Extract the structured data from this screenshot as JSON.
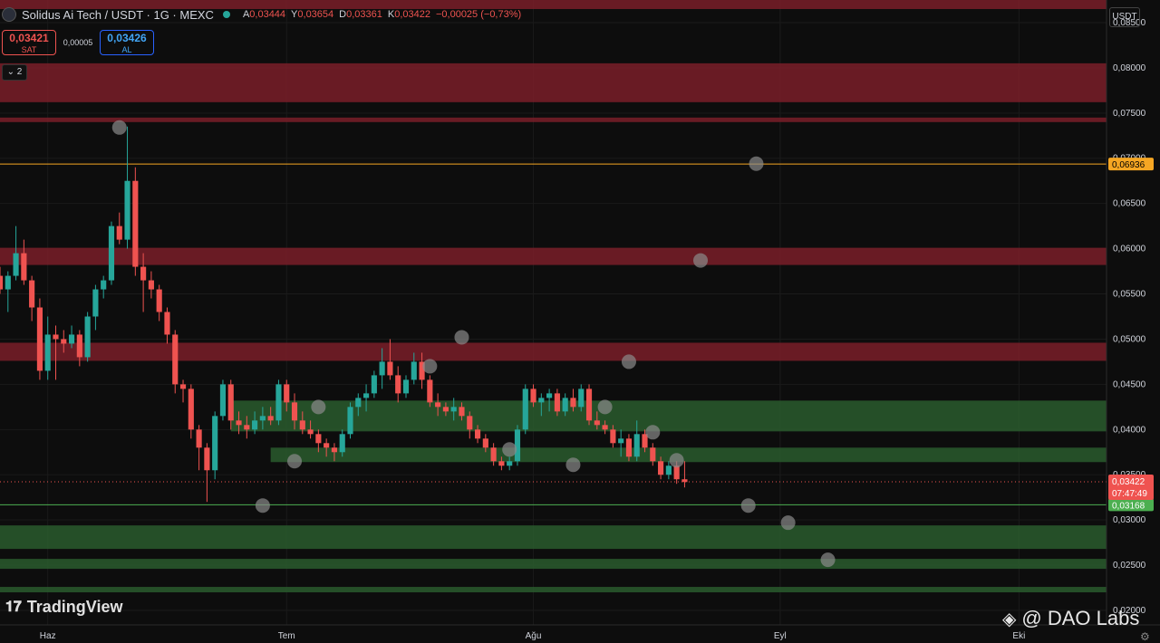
{
  "header": {
    "symbol": "Solidus Ai Tech / USDT · 1G · MEXC",
    "ohlc": [
      {
        "k": "A",
        "v": "0,03444"
      },
      {
        "k": "Y",
        "v": "0,03654"
      },
      {
        "k": "D",
        "v": "0,03361"
      },
      {
        "k": "K",
        "v": "0,03422"
      },
      {
        "k": "",
        "v": "−0,00025 (−0,73%)"
      }
    ]
  },
  "trade": {
    "sell_price": "0,03421",
    "sell_label": "SAT",
    "spread": "0,00005",
    "buy_price": "0,03426",
    "buy_label": "AL"
  },
  "collapse_label": "2",
  "currency": "USDT",
  "logo": "TradingView",
  "watermark": "@ DAO Labs",
  "colors": {
    "up": "#26a69a",
    "down": "#ef5350",
    "resistance": "#7a1f29",
    "support": "#2a5c2e",
    "orange": "#f5a623",
    "green_line": "#4caf50"
  },
  "chart_data": {
    "type": "candlestick",
    "y_ticks": [
      "0,08500",
      "0,08000",
      "0,07500",
      "0,07000",
      "0,06500",
      "0,06000",
      "0,05500",
      "0,05000",
      "0,04500",
      "0,04000",
      "0,03500",
      "0,03000",
      "0,02500",
      "0,02000"
    ],
    "y_tick_values": [
      0.085,
      0.08,
      0.075,
      0.07,
      0.065,
      0.06,
      0.055,
      0.05,
      0.045,
      0.04,
      0.035,
      0.03,
      0.025,
      0.02
    ],
    "ylim": [
      0.0184,
      0.0875
    ],
    "x_labels": [
      {
        "label": "Haz",
        "day": 0
      },
      {
        "label": "Tem",
        "day": 30
      },
      {
        "label": "Ağu",
        "day": 61
      },
      {
        "label": "Eyl",
        "day": 92
      },
      {
        "label": "Eki",
        "day": 122
      }
    ],
    "xlim_days": [
      -6,
      133
    ],
    "first_candle_day": -6,
    "candles": [
      [
        0.057,
        0.058,
        0.055,
        0.0555
      ],
      [
        0.0555,
        0.0575,
        0.053,
        0.057
      ],
      [
        0.057,
        0.0625,
        0.0565,
        0.0595
      ],
      [
        0.0595,
        0.061,
        0.056,
        0.0565
      ],
      [
        0.0565,
        0.057,
        0.052,
        0.0535
      ],
      [
        0.0535,
        0.0545,
        0.0455,
        0.0465
      ],
      [
        0.0465,
        0.0525,
        0.0455,
        0.0505
      ],
      [
        0.0505,
        0.0515,
        0.0455,
        0.05
      ],
      [
        0.05,
        0.051,
        0.0485,
        0.0495
      ],
      [
        0.0495,
        0.0515,
        0.049,
        0.0505
      ],
      [
        0.0505,
        0.051,
        0.047,
        0.048
      ],
      [
        0.048,
        0.053,
        0.0475,
        0.0525
      ],
      [
        0.0525,
        0.056,
        0.051,
        0.0555
      ],
      [
        0.0555,
        0.057,
        0.0545,
        0.0565
      ],
      [
        0.0565,
        0.063,
        0.056,
        0.0625
      ],
      [
        0.0625,
        0.064,
        0.0605,
        0.061
      ],
      [
        0.061,
        0.0735,
        0.06,
        0.0675
      ],
      [
        0.0675,
        0.069,
        0.057,
        0.058
      ],
      [
        0.058,
        0.0595,
        0.053,
        0.0565
      ],
      [
        0.0565,
        0.0575,
        0.0545,
        0.0555
      ],
      [
        0.0555,
        0.056,
        0.052,
        0.053
      ],
      [
        0.053,
        0.0535,
        0.0495,
        0.0505
      ],
      [
        0.0505,
        0.051,
        0.044,
        0.045
      ],
      [
        0.045,
        0.0455,
        0.043,
        0.0445
      ],
      [
        0.0445,
        0.045,
        0.039,
        0.04
      ],
      [
        0.04,
        0.0405,
        0.0355,
        0.038
      ],
      [
        0.038,
        0.0385,
        0.032,
        0.0355
      ],
      [
        0.0355,
        0.042,
        0.0345,
        0.0415
      ],
      [
        0.0415,
        0.0455,
        0.041,
        0.045
      ],
      [
        0.045,
        0.0455,
        0.04,
        0.041
      ],
      [
        0.041,
        0.042,
        0.0395,
        0.0405
      ],
      [
        0.0405,
        0.0415,
        0.039,
        0.04
      ],
      [
        0.04,
        0.042,
        0.0395,
        0.041
      ],
      [
        0.041,
        0.0425,
        0.04,
        0.0415
      ],
      [
        0.0415,
        0.0425,
        0.0405,
        0.041
      ],
      [
        0.041,
        0.0455,
        0.0405,
        0.045
      ],
      [
        0.045,
        0.0455,
        0.042,
        0.043
      ],
      [
        0.043,
        0.044,
        0.04,
        0.041
      ],
      [
        0.041,
        0.042,
        0.0395,
        0.04
      ],
      [
        0.04,
        0.041,
        0.039,
        0.0395
      ],
      [
        0.0395,
        0.04,
        0.0375,
        0.0385
      ],
      [
        0.0385,
        0.039,
        0.037,
        0.038
      ],
      [
        0.038,
        0.0385,
        0.0365,
        0.0375
      ],
      [
        0.0375,
        0.04,
        0.037,
        0.0395
      ],
      [
        0.0395,
        0.043,
        0.039,
        0.0425
      ],
      [
        0.0425,
        0.044,
        0.0415,
        0.0435
      ],
      [
        0.0435,
        0.045,
        0.042,
        0.044
      ],
      [
        0.044,
        0.0465,
        0.0435,
        0.046
      ],
      [
        0.046,
        0.049,
        0.0445,
        0.0475
      ],
      [
        0.0475,
        0.05,
        0.0455,
        0.046
      ],
      [
        0.046,
        0.047,
        0.043,
        0.044
      ],
      [
        0.044,
        0.046,
        0.0435,
        0.0455
      ],
      [
        0.0455,
        0.0485,
        0.045,
        0.0475
      ],
      [
        0.0475,
        0.0485,
        0.0445,
        0.0455
      ],
      [
        0.0455,
        0.046,
        0.0425,
        0.043
      ],
      [
        0.043,
        0.044,
        0.0415,
        0.0425
      ],
      [
        0.0425,
        0.043,
        0.0415,
        0.042
      ],
      [
        0.042,
        0.0435,
        0.041,
        0.0425
      ],
      [
        0.0425,
        0.043,
        0.041,
        0.0415
      ],
      [
        0.0415,
        0.042,
        0.039,
        0.04
      ],
      [
        0.04,
        0.0405,
        0.0385,
        0.039
      ],
      [
        0.039,
        0.0395,
        0.0375,
        0.038
      ],
      [
        0.038,
        0.0385,
        0.036,
        0.0365
      ],
      [
        0.0365,
        0.037,
        0.0355,
        0.036
      ],
      [
        0.036,
        0.037,
        0.0355,
        0.0365
      ],
      [
        0.0365,
        0.0405,
        0.036,
        0.04
      ],
      [
        0.04,
        0.045,
        0.0395,
        0.0445
      ],
      [
        0.0445,
        0.045,
        0.0425,
        0.043
      ],
      [
        0.043,
        0.044,
        0.0415,
        0.0435
      ],
      [
        0.0435,
        0.0445,
        0.042,
        0.044
      ],
      [
        0.044,
        0.0445,
        0.0415,
        0.042
      ],
      [
        0.042,
        0.044,
        0.0415,
        0.0435
      ],
      [
        0.0435,
        0.0445,
        0.042,
        0.0425
      ],
      [
        0.0425,
        0.045,
        0.042,
        0.0445
      ],
      [
        0.0445,
        0.045,
        0.0405,
        0.041
      ],
      [
        0.041,
        0.042,
        0.04,
        0.0405
      ],
      [
        0.0405,
        0.041,
        0.0395,
        0.04
      ],
      [
        0.04,
        0.0405,
        0.038,
        0.0385
      ],
      [
        0.0385,
        0.04,
        0.037,
        0.039
      ],
      [
        0.039,
        0.0395,
        0.0365,
        0.037
      ],
      [
        0.037,
        0.041,
        0.0365,
        0.0395
      ],
      [
        0.0395,
        0.04,
        0.0375,
        0.038
      ],
      [
        0.038,
        0.0385,
        0.036,
        0.0365
      ],
      [
        0.0365,
        0.037,
        0.0345,
        0.035
      ],
      [
        0.035,
        0.0365,
        0.0345,
        0.036
      ],
      [
        0.036,
        0.0365,
        0.034,
        0.0345
      ],
      [
        0.0345,
        0.0365,
        0.0336,
        0.0342
      ]
    ],
    "resistance_zones": [
      [
        0.0865,
        0.0888
      ],
      [
        0.0762,
        0.0805
      ],
      [
        0.074,
        0.0745
      ],
      [
        0.0582,
        0.0601
      ],
      [
        0.0476,
        0.0496
      ]
    ],
    "support_zones": [
      [
        0.0398,
        0.0432
      ],
      [
        0.0364,
        0.038
      ],
      [
        0.0268,
        0.0294
      ],
      [
        0.0246,
        0.0257
      ],
      [
        0.022,
        0.0226
      ]
    ],
    "lines": [
      {
        "price": 0.06936,
        "label": "0,06936",
        "color": "#f5a623"
      },
      {
        "price": 0.03168,
        "label": "0,03168",
        "color": "#4caf50"
      }
    ],
    "current": {
      "price": 0.03422,
      "label": "0,03422",
      "timer": "07:47:49"
    },
    "markers": [
      [
        9,
        0.0734
      ],
      [
        27,
        0.0316
      ],
      [
        31,
        0.0365
      ],
      [
        34,
        0.0425
      ],
      [
        48,
        0.047
      ],
      [
        52,
        0.0502
      ],
      [
        58,
        0.0378
      ],
      [
        66,
        0.0361
      ],
      [
        70,
        0.0425
      ],
      [
        73,
        0.0475
      ],
      [
        76,
        0.0397
      ],
      [
        79,
        0.0366
      ],
      [
        82,
        0.0587
      ],
      [
        88,
        0.0316
      ],
      [
        89,
        0.0694
      ],
      [
        93,
        0.0297
      ],
      [
        98,
        0.0256
      ]
    ]
  }
}
